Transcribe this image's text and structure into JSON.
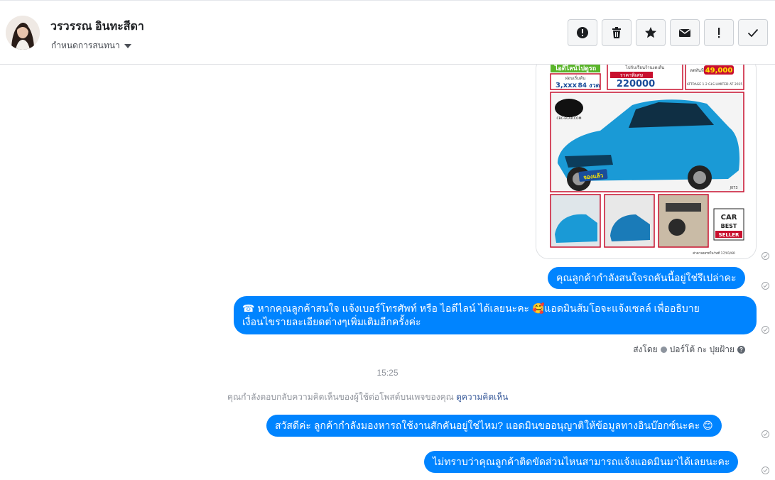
{
  "header": {
    "contact_name": "วรวรรณ อินทะสีดา",
    "assign_label": "กำหนดการสนทนา",
    "actions": [
      {
        "name": "spam-button",
        "icon": "alert-circle-icon"
      },
      {
        "name": "delete-button",
        "icon": "trash-icon"
      },
      {
        "name": "star-button",
        "icon": "star-icon"
      },
      {
        "name": "mark-unread-button",
        "icon": "envelope-icon"
      },
      {
        "name": "follow-up-button",
        "icon": "exclamation-icon"
      },
      {
        "name": "mark-done-button",
        "icon": "checkmark-icon"
      }
    ]
  },
  "image_message": {
    "ad_header": "ไอดีไลน์ไปดูรถ",
    "down_label": "ผ่อนเริ่มต้น",
    "down_value": "3,xxx",
    "months": "84 งวด",
    "price_label": "ราคาพิเศษ",
    "price_value": "220000",
    "special_label": "ลดทันที",
    "special_value": "49,000",
    "promo_small": "ไปกับเรือนร้านงดเส้น",
    "model_text": "ATTRAGE 1.2 GLS LIMITED AT 2015",
    "stamp_text": "จองแล้ว",
    "code_text": "J073",
    "badge_line1": "CAR",
    "badge_line2": "BEST",
    "badge_line3": "SELLER",
    "date_text": "ค่าดวจอยรถในวันที่ 17/01/60",
    "logo_text": "CBC-ECAR.COM"
  },
  "messages": {
    "m1": "คุณลูกค้ากำลังสนใจรถคันนี้อยู่ใช่รึเปล่าคะ",
    "m2_line1": "☎ หากคุณลูกค้าสนใจ แจ้งเบอร์โทรศัพท์ หรือ ไอดีไลน์  ได้เลยนะคะ 🥰แอดมินส้มโอจะแจ้งเซลล์   เพื่ออธิบาย",
    "m2_line2": "เงื่อนไขรายละเอียดต่างๆเพิ่มเติมอีกครั้งค่ะ",
    "m3": "สวัสดีค่ะ ลูกค้ากำลังมองหารถใช้งานสักคันอยู่ใช่ไหม? แอดมินขออนุญาติให้ข้อมูลทางอินบ๊อกซ์นะคะ 😊",
    "m4": "ไม่ทราบว่าคุณลูกค้าติดขัดส่วนไหนสามารถแจ้งแอดมินมาได้เลยนะคะ"
  },
  "sent_by": {
    "prefix": "ส่งโดย",
    "name": "ปอร์โต้ กะ ปุยฝ้าย",
    "help": "?"
  },
  "time_divider": "15:25",
  "notice": {
    "text": "คุณกำลังตอบกลับความคิดเห็นของผู้ใช้ต่อโพสต์บนเพจของคุณ",
    "link": "ดูความคิดเห็น"
  },
  "colors": {
    "bubble": "#0084ff",
    "car": "#1a9ad6",
    "ad_border": "#c8102e",
    "ad_accent": "#5ab52a"
  }
}
